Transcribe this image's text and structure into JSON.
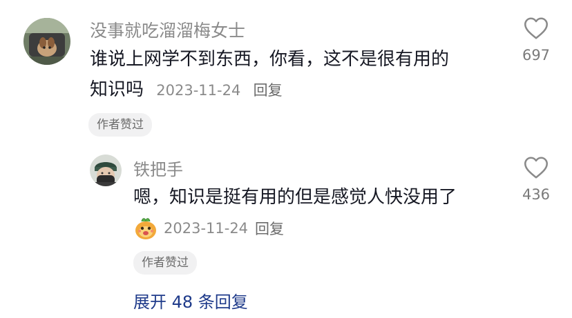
{
  "comments": [
    {
      "username": "没事就吃溜溜梅女士",
      "text_line1": "谁说上网学不到东西，你看，这不是很有用的",
      "text_line2": "知识吗",
      "date": "2023-11-24",
      "reply_label": "回复",
      "badge": "作者赞过",
      "likes": "697"
    },
    {
      "username": "铁把手",
      "text": "嗯，知识是挺有用的但是感觉人快没用了",
      "date": "2023-11-24",
      "reply_label": "回复",
      "badge": "作者赞过",
      "likes": "436"
    }
  ],
  "expand_label": "展开 48 条回复"
}
